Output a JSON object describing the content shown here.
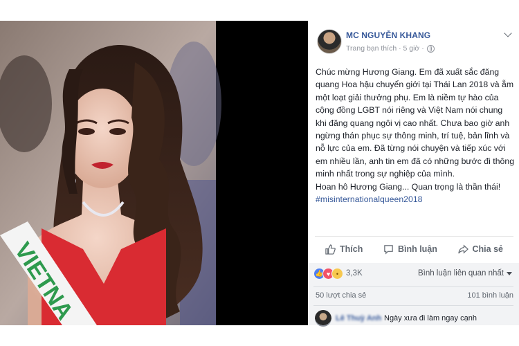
{
  "post": {
    "author": "MC NGUYỄN KHANG",
    "meta": "Trang bạn thích · 5 giờ ·",
    "paragraphs": [
      "Chúc mừng Hương Giang. Em đã xuất sắc đăng quang Hoa hậu chuyển giới tại Thái Lan 2018 và ẵm một loạt giải thưởng phụ. Em là niềm tự hào của cộng đồng LGBT nói riêng và Việt Nam nói chung khi đăng quang ngôi vị cao nhất. Chưa bao giờ anh ngừng thán phục sự thông minh, trí tuệ, bản lĩnh và nỗ lực của em. Đã từng nói chuyện và tiếp xúc với em nhiều lần, anh tin em đã có những bước đi thông minh nhất trong sự nghiệp của mình.",
      "Hoan hô Hương Giang... Quan trọng là thần thái!"
    ],
    "hashtag": "#misinternationalqueen2018"
  },
  "photo": {
    "sash_text": "VIETNA"
  },
  "actions": {
    "like": "Thích",
    "comment": "Bình luận",
    "share": "Chia sẻ"
  },
  "summary": {
    "reaction_count": "3,3K",
    "sort_label": "Bình luận liên quan nhất",
    "shares": "50 lượt chia sẻ",
    "comments": "101 bình luận"
  },
  "comment": {
    "author": "Lê Thuỳ Anh",
    "text": "Ngày xưa đi làm ngay cạnh"
  },
  "colors": {
    "link": "#365899",
    "like": "#4f7ff1",
    "love": "#f25268",
    "wow": "#f7c84e",
    "sash": "#2e9a4e",
    "dress": "#d92b32"
  }
}
